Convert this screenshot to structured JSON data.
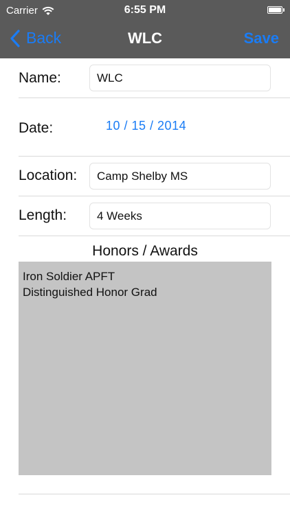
{
  "status_bar": {
    "carrier": "Carrier",
    "time": "6:55 PM",
    "battery_level": 1.0
  },
  "nav": {
    "back_label": "Back",
    "title": "WLC",
    "save_label": "Save"
  },
  "form": {
    "name_label": "Name:",
    "name_value": "WLC",
    "date_label": "Date:",
    "date_value": "10 / 15 / 2014",
    "location_label": "Location:",
    "location_value": "Camp Shelby MS",
    "length_label": "Length:",
    "length_value": "4 Weeks"
  },
  "honors": {
    "heading": "Honors / Awards",
    "lines": [
      "Iron Soldier APFT",
      "Distinguished Honor Grad"
    ]
  },
  "colors": {
    "header_bg": "#5a5a5a",
    "accent": "#1a7cf5",
    "awards_bg": "#c4c4c4"
  }
}
